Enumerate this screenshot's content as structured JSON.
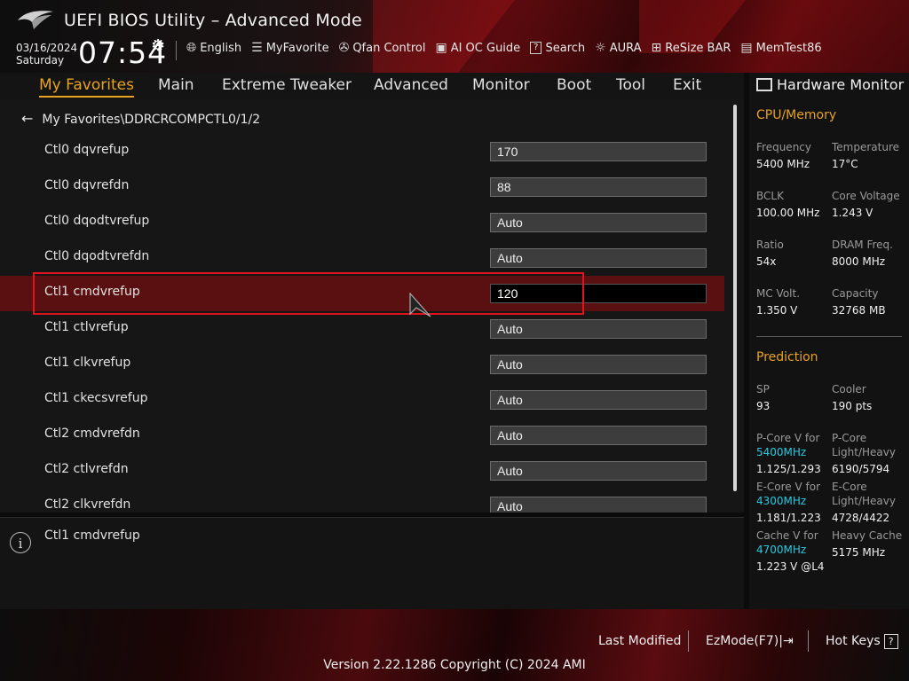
{
  "header": {
    "title": "UEFI BIOS Utility – Advanced Mode",
    "date": "03/16/2024",
    "day": "Saturday",
    "time": "07:54",
    "tools": [
      {
        "icon": "globe-icon",
        "label": "English"
      },
      {
        "icon": "favorite-list-icon",
        "label": "MyFavorite"
      },
      {
        "icon": "fan-icon",
        "label": "Qfan Control"
      },
      {
        "icon": "ai-chip-icon",
        "label": "AI OC Guide"
      },
      {
        "icon": "question-icon",
        "label": "Search"
      },
      {
        "icon": "aura-light-icon",
        "label": "AURA"
      },
      {
        "icon": "resize-bar-icon",
        "label": "ReSize BAR"
      },
      {
        "icon": "memory-test-icon",
        "label": "MemTest86"
      }
    ]
  },
  "menu": {
    "items": [
      "My Favorites",
      "Main",
      "Extreme Tweaker",
      "Advanced",
      "Monitor",
      "Boot",
      "Tool",
      "Exit"
    ],
    "active": "My Favorites"
  },
  "breadcrumb": "My Favorites\\DDRCRCOMPCTL0/1/2",
  "settings": [
    {
      "label": "Ctl0 dqvrefup",
      "value": "170"
    },
    {
      "label": "Ctl0 dqvrefdn",
      "value": "88"
    },
    {
      "label": "Ctl0 dqodtvrefup",
      "value": "Auto"
    },
    {
      "label": "Ctl0 dqodtvrefdn",
      "value": "Auto"
    },
    {
      "label": "Ctl1 cmdvrefup",
      "value": "120"
    },
    {
      "label": "Ctl1 ctlvrefup",
      "value": "Auto"
    },
    {
      "label": "Ctl1 clkvrefup",
      "value": "Auto"
    },
    {
      "label": "Ctl1 ckecsvrefup",
      "value": "Auto"
    },
    {
      "label": "Ctl2 cmdvrefdn",
      "value": "Auto"
    },
    {
      "label": "Ctl2 ctlvrefdn",
      "value": "Auto"
    },
    {
      "label": "Ctl2 clkvrefdn",
      "value": "Auto"
    }
  ],
  "help": {
    "text": "Ctl1 cmdvrefup"
  },
  "hw_monitor": {
    "title": "Hardware Monitor",
    "cpu_memory": {
      "title": "CPU/Memory",
      "frequency_label": "Frequency",
      "frequency": "5400 MHz",
      "temperature_label": "Temperature",
      "temperature": "17°C",
      "bclk_label": "BCLK",
      "bclk": "100.00 MHz",
      "core_voltage_label": "Core Voltage",
      "core_voltage": "1.243 V",
      "ratio_label": "Ratio",
      "ratio": "54x",
      "dram_freq_label": "DRAM Freq.",
      "dram_freq": "8000 MHz",
      "mc_volt_label": "MC Volt.",
      "mc_volt": "1.350 V",
      "capacity_label": "Capacity",
      "capacity": "32768 MB"
    },
    "prediction": {
      "title": "Prediction",
      "sp_label": "SP",
      "sp": "93",
      "cooler_label": "Cooler",
      "cooler": "190 pts",
      "pcore_v_label": "P-Core V for",
      "pcore_v_freq": "5400MHz",
      "pcore_v": "1.125/1.293",
      "pcore_lh_label_1": "P-Core",
      "pcore_lh_label_2": "Light/Heavy",
      "pcore_lh": "6190/5794",
      "ecore_v_label": "E-Core V for",
      "ecore_v_freq": "4300MHz",
      "ecore_v": "1.181/1.223",
      "ecore_lh_label_1": "E-Core",
      "ecore_lh_label_2": "Light/Heavy",
      "ecore_lh": "4728/4422",
      "cache_v_label": "Cache V for",
      "cache_v_freq": "4700MHz",
      "cache_v": "1.223 V @L4",
      "heavy_cache_label": "Heavy Cache",
      "heavy_cache": "5175 MHz"
    }
  },
  "footer": {
    "last_modified": "Last Modified",
    "ezmode": "EzMode(F7)",
    "hotkeys": "Hot Keys",
    "hotkeys_key": "?",
    "version": "Version 2.22.1286 Copyright (C) 2024 AMI"
  },
  "colors": {
    "accent": "#e8a320",
    "selection": "#5a1010",
    "highlight_box": "#e0141e",
    "cyan": "#2cc8e0"
  }
}
